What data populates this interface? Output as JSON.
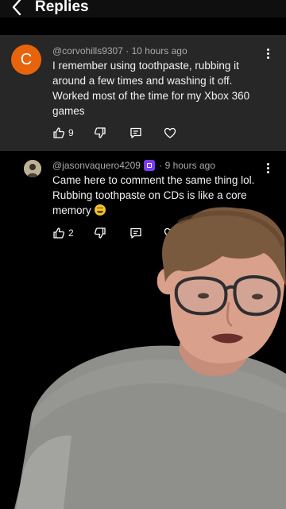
{
  "header": {
    "title": "Replies"
  },
  "parent_comment": {
    "avatar_letter": "C",
    "author": "@corvohills9307",
    "time": "10 hours ago",
    "text_lines": [
      "I remember using toothpaste, rubbing it",
      "around a few times and washing it off.",
      "Worked most of the time for my Xbox 360",
      "games"
    ],
    "likes": "9"
  },
  "reply": {
    "author": "@jasonvaquero4209",
    "time": "9 hours ago",
    "text_lines": [
      "Came here to comment the same thing lol.",
      "Rubbing toothpaste on CDs is like a core",
      "memory"
    ],
    "likes": "2"
  },
  "separator": "·",
  "colors": {
    "background": "#000000",
    "parent_background": "#272727",
    "avatar_orange": "#e8640c",
    "badge_purple": "#7a3cf0",
    "meta_text": "#aaaaaa",
    "body_text": "#f1f1f1"
  },
  "icons": [
    "back-arrow-icon",
    "more-vertical-icon",
    "thumbs-up-icon",
    "thumbs-down-icon",
    "comment-icon",
    "heart-icon",
    "member-badge-icon",
    "laughing-emoji-icon"
  ],
  "overlay": "webcam-person"
}
